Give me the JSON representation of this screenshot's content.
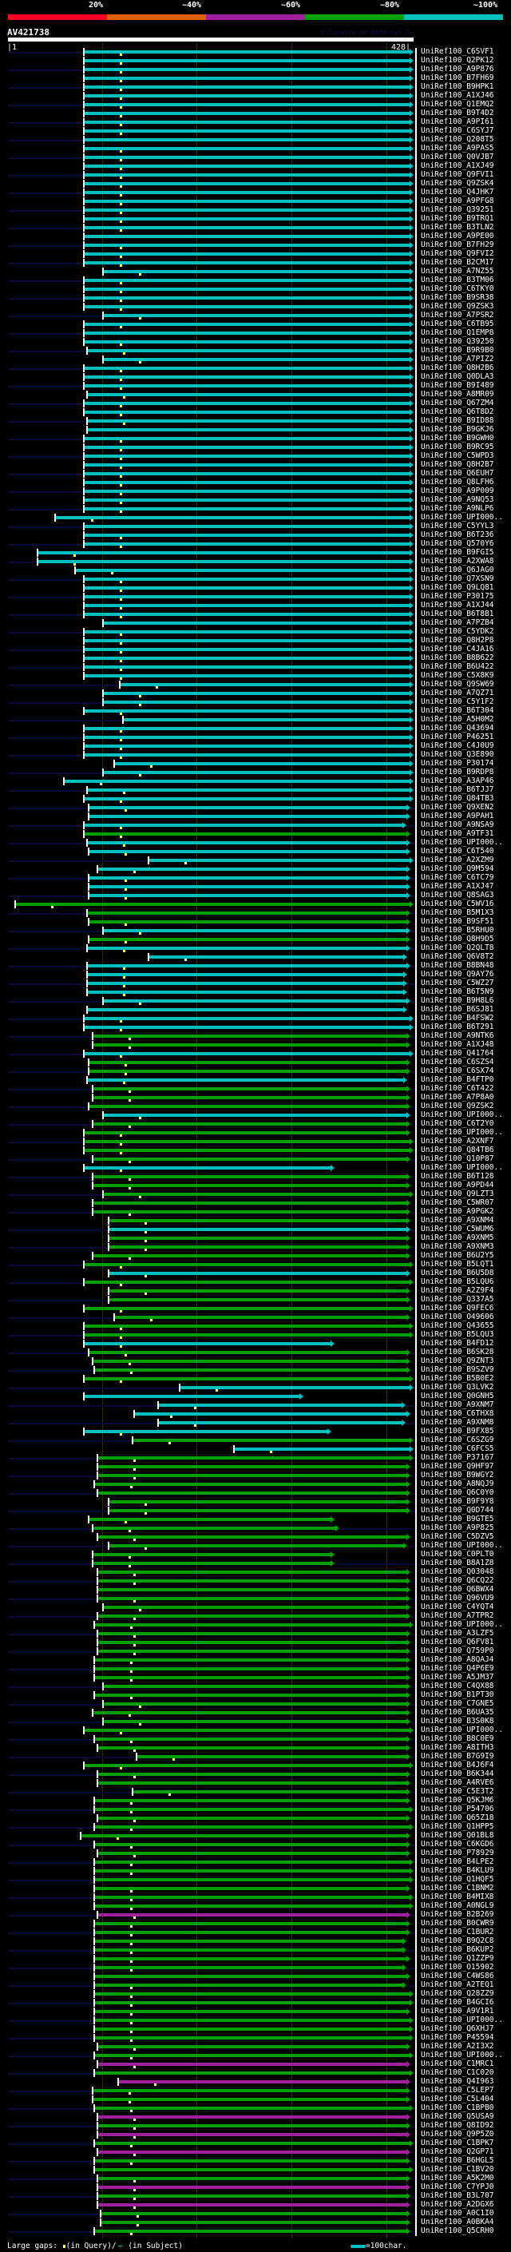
{
  "identity_legend": [
    {
      "label": "20%",
      "color": "#ff0022"
    },
    {
      "label": "~40%",
      "color": "#e06000"
    },
    {
      "label": "~60%",
      "color": "#a020a0"
    },
    {
      "label": "~80%",
      "color": "#00a000"
    },
    {
      "label": "~100%",
      "color": "#00c0c0"
    }
  ],
  "colors": {
    "c": "#00c0c0",
    "g": "#00a000",
    "m": "#a020a0"
  },
  "query": {
    "name": "AV421738",
    "version": "AlignView.pm Beta rel.7",
    "start_label": "|1",
    "end_label": "428|",
    "length": 428
  },
  "footer": {
    "large_gaps": "Large gaps:",
    "in_query": "(in Query)/",
    "in_subject": "(in Subject)",
    "scale": "=100char."
  },
  "rows": [
    [
      "UniRef100_C6SVF1",
      "c",
      81,
      425
    ],
    [
      "UniRef100_Q2PK12",
      "c",
      81,
      425
    ],
    [
      "UniRef100_A9P876",
      "c",
      81,
      425
    ],
    [
      "UniRef100_B7FH69",
      "c",
      81,
      425
    ],
    [
      "UniRef100_B9HPK1",
      "c",
      81,
      425
    ],
    [
      "UniRef100_A1XJ46",
      "c",
      81,
      425
    ],
    [
      "UniRef100_Q1EMQ2",
      "c",
      81,
      425
    ],
    [
      "UniRef100_B9T4D2",
      "c",
      81,
      425
    ],
    [
      "UniRef100_A9PI61",
      "c",
      81,
      425
    ],
    [
      "UniRef100_C6SYJ7",
      "c",
      81,
      425
    ],
    [
      "UniRef100_Q208T5",
      "c",
      81,
      425
    ],
    [
      "UniRef100_A9PAS5",
      "c",
      81,
      425
    ],
    [
      "UniRef100_Q0VJB7",
      "c",
      81,
      425
    ],
    [
      "UniRef100_A1XJ49",
      "c",
      81,
      425
    ],
    [
      "UniRef100_Q9FVI1",
      "c",
      81,
      425
    ],
    [
      "UniRef100_Q9ZSK4",
      "c",
      81,
      425
    ],
    [
      "UniRef100_Q4JHK7",
      "c",
      81,
      425
    ],
    [
      "UniRef100_A9PFG8",
      "c",
      81,
      425
    ],
    [
      "UniRef100_Q39251",
      "c",
      81,
      425
    ],
    [
      "UniRef100_B9TRQ1",
      "c",
      81,
      425
    ],
    [
      "UniRef100_B3TLN2",
      "c",
      81,
      425
    ],
    [
      "UniRef100_A9PE00",
      "c",
      81,
      425
    ],
    [
      "UniRef100_B7FH29",
      "c",
      81,
      425
    ],
    [
      "UniRef100_Q9FVI2",
      "c",
      81,
      425
    ],
    [
      "UniRef100_B2CM17",
      "c",
      81,
      425
    ],
    [
      "UniRef100_A7NZ55",
      "c",
      101,
      425
    ],
    [
      "UniRef100_B3TM06",
      "c",
      81,
      425
    ],
    [
      "UniRef100_C6TKY0",
      "c",
      81,
      425
    ],
    [
      "UniRef100_B9SR38",
      "c",
      81,
      425
    ],
    [
      "UniRef100_Q9ZSK3",
      "c",
      81,
      425
    ],
    [
      "UniRef100_A7PSR2",
      "c",
      101,
      425
    ],
    [
      "UniRef100_C6TB95",
      "c",
      81,
      425
    ],
    [
      "UniRef100_Q1EMP8",
      "c",
      81,
      425
    ],
    [
      "UniRef100_Q39250",
      "c",
      81,
      425
    ],
    [
      "UniRef100_B9R9B0",
      "c",
      84,
      425
    ],
    [
      "UniRef100_A7PIZ2",
      "c",
      101,
      425
    ],
    [
      "UniRef100_Q8H2B6",
      "c",
      81,
      425
    ],
    [
      "UniRef100_Q0DLA3",
      "c",
      81,
      425
    ],
    [
      "UniRef100_B9I489",
      "c",
      81,
      425
    ],
    [
      "UniRef100_A8MR09",
      "c",
      84,
      425
    ],
    [
      "UniRef100_Q67ZM4",
      "c",
      81,
      425
    ],
    [
      "UniRef100_Q6T8D2",
      "c",
      81,
      425
    ],
    [
      "UniRef100_B9ID88",
      "c",
      84,
      425
    ],
    [
      "UniRef100_B9GKJ6",
      "c",
      84,
      425
    ],
    [
      "UniRef100_B9GWH0",
      "c",
      81,
      425
    ],
    [
      "UniRef100_B9RC95",
      "c",
      81,
      425
    ],
    [
      "UniRef100_C5WPD3",
      "c",
      81,
      425
    ],
    [
      "UniRef100_Q8H2B7",
      "c",
      81,
      425
    ],
    [
      "UniRef100_Q6EUH7",
      "c",
      81,
      425
    ],
    [
      "UniRef100_Q8LFH6",
      "c",
      81,
      425
    ],
    [
      "UniRef100_A9P009",
      "c",
      81,
      425
    ],
    [
      "UniRef100_A9NQ53",
      "c",
      81,
      425
    ],
    [
      "UniRef100_A9NLP6",
      "c",
      81,
      425
    ],
    [
      "UniRef100_UPI000..",
      "c",
      51,
      425
    ],
    [
      "UniRef100_C5YYL3",
      "c",
      81,
      425
    ],
    [
      "UniRef100_B6T236",
      "c",
      81,
      425
    ],
    [
      "UniRef100_Q570Y6",
      "c",
      81,
      425
    ],
    [
      "UniRef100_B9FGI5",
      "c",
      32,
      425
    ],
    [
      "UniRef100_A2XWA8",
      "c",
      32,
      425
    ],
    [
      "UniRef100_Q6JAG0",
      "c",
      72,
      425
    ],
    [
      "UniRef100_Q7XSN9",
      "c",
      81,
      425
    ],
    [
      "UniRef100_Q9LQ81",
      "c",
      81,
      425
    ],
    [
      "UniRef100_P30175",
      "c",
      81,
      425
    ],
    [
      "UniRef100_A1XJ44",
      "c",
      81,
      425
    ],
    [
      "UniRef100_B6T8B1",
      "c",
      81,
      425
    ],
    [
      "UniRef100_A7PZB4",
      "c",
      101,
      425
    ],
    [
      "UniRef100_C5YDK2",
      "c",
      81,
      425
    ],
    [
      "UniRef100_Q8H2P8",
      "c",
      81,
      425
    ],
    [
      "UniRef100_C4JA16",
      "c",
      81,
      425
    ],
    [
      "UniRef100_B8B622",
      "c",
      81,
      425
    ],
    [
      "UniRef100_B6U422",
      "c",
      81,
      425
    ],
    [
      "UniRef100_C5X8K9",
      "c",
      81,
      425
    ],
    [
      "UniRef100_Q9SW69",
      "c",
      119,
      425
    ],
    [
      "UniRef100_A7QZ71",
      "c",
      101,
      425
    ],
    [
      "UniRef100_C5Y1F2",
      "c",
      101,
      425
    ],
    [
      "UniRef100_B6T304",
      "c",
      81,
      425
    ],
    [
      "UniRef100_A5H0M2",
      "c",
      122,
      425
    ],
    [
      "UniRef100_Q43694",
      "c",
      81,
      425
    ],
    [
      "UniRef100_P46251",
      "c",
      81,
      425
    ],
    [
      "UniRef100_C4J0U9",
      "c",
      81,
      425
    ],
    [
      "UniRef100_Q3E890",
      "c",
      81,
      425
    ],
    [
      "UniRef100_P30174",
      "c",
      113,
      425
    ],
    [
      "UniRef100_B9RDP8",
      "c",
      101,
      425
    ],
    [
      "UniRef100_A3AP46",
      "c",
      60,
      425
    ],
    [
      "UniRef100_B6TJJ7",
      "c",
      84,
      425
    ],
    [
      "UniRef100_Q84TB3",
      "c",
      81,
      425
    ],
    [
      "UniRef100_Q9XEN2",
      "c",
      86,
      421
    ],
    [
      "UniRef100_A9PAH1",
      "c",
      86,
      421
    ],
    [
      "UniRef100_A9NSA9",
      "c",
      81,
      417
    ],
    [
      "UniRef100_A9TF31",
      "g",
      81,
      421
    ],
    [
      "UniRef100_UPI000..",
      "c",
      84,
      421
    ],
    [
      "UniRef100_C6T540",
      "c",
      86,
      421
    ],
    [
      "UniRef100_A2XZM9",
      "c",
      149,
      425
    ],
    [
      "UniRef100_Q9M594",
      "c",
      95,
      421
    ],
    [
      "UniRef100_C6TC79",
      "c",
      86,
      421
    ],
    [
      "UniRef100_A1XJ47",
      "c",
      86,
      421
    ],
    [
      "UniRef100_Q8SAG3",
      "c",
      86,
      421
    ],
    [
      "UniRef100_C5WV16",
      "g",
      9,
      425
    ],
    [
      "UniRef100_B5M1X3",
      "g",
      84,
      421
    ],
    [
      "UniRef100_B9SF51",
      "g",
      86,
      421
    ],
    [
      "UniRef100_B5RHU0",
      "c",
      101,
      421
    ],
    [
      "UniRef100_Q8H9D5",
      "g",
      86,
      421
    ],
    [
      "UniRef100_Q2QLT8",
      "c",
      84,
      421
    ],
    [
      "UniRef100_Q6V8T2",
      "c",
      149,
      418
    ],
    [
      "UniRef100_B8BN48",
      "c",
      84,
      421
    ],
    [
      "UniRef100_Q9AY76",
      "c",
      84,
      418
    ],
    [
      "UniRef100_C5WZ27",
      "c",
      84,
      418
    ],
    [
      "UniRef100_B6T5N9",
      "c",
      84,
      418
    ],
    [
      "UniRef100_B9H8L6",
      "c",
      101,
      421
    ],
    [
      "UniRef100_B6SJ81",
      "c",
      84,
      418
    ],
    [
      "UniRef100_B4FSW2",
      "c",
      81,
      425
    ],
    [
      "UniRef100_B6T291",
      "c",
      81,
      425
    ],
    [
      "UniRef100_A9NTK6",
      "g",
      90,
      421
    ],
    [
      "UniRef100_A1XJ48",
      "g",
      90,
      421
    ],
    [
      "UniRef100_Q41764",
      "c",
      81,
      425
    ],
    [
      "UniRef100_C6SZS4",
      "g",
      86,
      421
    ],
    [
      "UniRef100_C6SX74",
      "g",
      86,
      421
    ],
    [
      "UniRef100_B4FTP0",
      "c",
      84,
      418
    ],
    [
      "UniRef100_C6T422",
      "g",
      90,
      421
    ],
    [
      "UniRef100_A7P8A0",
      "g",
      90,
      421
    ],
    [
      "UniRef100_Q9ZSK2",
      "g",
      86,
      421
    ],
    [
      "UniRef100_UPI000..",
      "c",
      101,
      421
    ],
    [
      "UniRef100_C6T2Y0",
      "g",
      90,
      421
    ],
    [
      "UniRef100_UPI000..",
      "g",
      81,
      421
    ],
    [
      "UniRef100_A2XNF7",
      "g",
      81,
      425
    ],
    [
      "UniRef100_Q84TB6",
      "g",
      81,
      425
    ],
    [
      "UniRef100_Q10P87",
      "g",
      90,
      421
    ],
    [
      "UniRef100_UPI000..",
      "c",
      81,
      341
    ],
    [
      "UniRef100_B6T128",
      "g",
      90,
      421
    ],
    [
      "UniRef100_A9PD44",
      "g",
      90,
      421
    ],
    [
      "UniRef100_Q9LZT3",
      "g",
      101,
      425
    ],
    [
      "UniRef100_C5WR07",
      "g",
      90,
      421
    ],
    [
      "UniRef100_A9PGK2",
      "g",
      90,
      421
    ],
    [
      "UniRef100_A9XNM4",
      "g",
      107,
      421
    ],
    [
      "UniRef100_C5WUM6",
      "c",
      107,
      421
    ],
    [
      "UniRef100_A9XNM5",
      "g",
      107,
      421
    ],
    [
      "UniRef100_A9XNM3",
      "g",
      107,
      421
    ],
    [
      "UniRef100_B6U2Y5",
      "g",
      90,
      421
    ],
    [
      "UniRef100_B5LQT1",
      "g",
      81,
      425
    ],
    [
      "UniRef100_B6U5D8",
      "c",
      107,
      421
    ],
    [
      "UniRef100_B5LQU6",
      "g",
      81,
      425
    ],
    [
      "UniRef100_A2Z9F4",
      "g",
      107,
      421
    ],
    [
      "UniRef100_Q337A5",
      "g",
      107,
      421
    ],
    [
      "UniRef100_Q9FEC6",
      "g",
      81,
      425
    ],
    [
      "UniRef100_O49606",
      "g",
      113,
      421
    ],
    [
      "UniRef100_Q43655",
      "g",
      81,
      425
    ],
    [
      "UniRef100_B5LQU3",
      "g",
      81,
      425
    ],
    [
      "UniRef100_B4FD12",
      "c",
      81,
      341
    ],
    [
      "UniRef100_B6SK28",
      "g",
      86,
      421
    ],
    [
      "UniRef100_Q9ZNT3",
      "g",
      90,
      421
    ],
    [
      "UniRef100_B9SZV9",
      "g",
      92,
      421
    ],
    [
      "UniRef100_B5B0E2",
      "g",
      81,
      425
    ],
    [
      "UniRef100_Q3LVK2",
      "c",
      182,
      425
    ],
    [
      "UniRef100_Q0GNH5",
      "c",
      81,
      308
    ],
    [
      "UniRef100_A9XNM7",
      "c",
      159,
      416
    ],
    [
      "UniRef100_C6THX8",
      "c",
      134,
      421
    ],
    [
      "UniRef100_A9XNM8",
      "c",
      159,
      416
    ],
    [
      "UniRef100_B9FX85",
      "c",
      81,
      338
    ],
    [
      "UniRef100_C6SZG9",
      "g",
      132,
      425
    ],
    [
      "UniRef100_C6FCS5",
      "c",
      239,
      425
    ],
    [
      "UniRef100_P37167",
      "g",
      95,
      425
    ],
    [
      "UniRef100_Q9HF97",
      "g",
      95,
      421
    ],
    [
      "UniRef100_B9WGY2",
      "g",
      95,
      421
    ],
    [
      "UniRef100_A8NQJ9",
      "g",
      92,
      421
    ],
    [
      "UniRef100_Q6C0Y0",
      "g",
      95,
      421
    ],
    [
      "UniRef100_B9F9Y8",
      "g",
      107,
      421
    ],
    [
      "UniRef100_Q0D744",
      "g",
      107,
      421
    ],
    [
      "UniRef100_B9GTE5",
      "g",
      86,
      341
    ],
    [
      "UniRef100_A9P825",
      "g",
      90,
      346
    ],
    [
      "UniRef100_C5DZV5",
      "g",
      95,
      421
    ],
    [
      "UniRef100_UPI000..",
      "g",
      107,
      418
    ],
    [
      "UniRef100_C0PLT0",
      "g",
      90,
      341
    ],
    [
      "UniRef100_B8A1Z8",
      "g",
      90,
      341
    ],
    [
      "UniRef100_Q03048",
      "g",
      95,
      421
    ],
    [
      "UniRef100_Q6CQ22",
      "g",
      95,
      421
    ],
    [
      "UniRef100_Q6BWX4",
      "g",
      95,
      421
    ],
    [
      "UniRef100_Q96VU9",
      "g",
      95,
      421
    ],
    [
      "UniRef100_C4YQT4",
      "g",
      101,
      421
    ],
    [
      "UniRef100_A7TPR2",
      "g",
      95,
      421
    ],
    [
      "UniRef100_UPI000..",
      "g",
      92,
      425
    ],
    [
      "UniRef100_A3LZF5",
      "g",
      95,
      421
    ],
    [
      "UniRef100_Q6FV81",
      "g",
      95,
      421
    ],
    [
      "UniRef100_Q759P0",
      "g",
      95,
      421
    ],
    [
      "UniRef100_A8QAJ4",
      "g",
      92,
      421
    ],
    [
      "UniRef100_Q4P6E9",
      "g",
      92,
      421
    ],
    [
      "UniRef100_A5JM37",
      "g",
      92,
      421
    ],
    [
      "UniRef100_C4QX88",
      "g",
      101,
      421
    ],
    [
      "UniRef100_B1PT30",
      "g",
      92,
      421
    ],
    [
      "UniRef100_C7GNE5",
      "g",
      101,
      421
    ],
    [
      "UniRef100_B6UA35",
      "g",
      90,
      421
    ],
    [
      "UniRef100_B3S0K8",
      "g",
      101,
      421
    ],
    [
      "UniRef100_UPI000..",
      "g",
      81,
      425
    ],
    [
      "UniRef100_B8C0E9",
      "g",
      92,
      421
    ],
    [
      "UniRef100_A8ITH3",
      "g",
      95,
      421
    ],
    [
      "UniRef100_B7G9I9",
      "g",
      137,
      421
    ],
    [
      "UniRef100_B4J6F4",
      "g",
      81,
      425
    ],
    [
      "UniRef100_B6K344",
      "g",
      95,
      421
    ],
    [
      "UniRef100_A4RVE6",
      "g",
      95,
      421
    ],
    [
      "UniRef100_C5E3T2",
      "g",
      132,
      421
    ],
    [
      "UniRef100_Q5KJM6",
      "g",
      92,
      421
    ],
    [
      "UniRef100_P54706",
      "g",
      92,
      425
    ],
    [
      "UniRef100_Q65Z18",
      "g",
      95,
      421
    ],
    [
      "UniRef100_Q1HPP5",
      "g",
      92,
      425
    ],
    [
      "UniRef100_Q01BL8",
      "g",
      78,
      421
    ],
    [
      "UniRef100_C6KGD6",
      "g",
      92,
      421
    ],
    [
      "UniRef100_P78929",
      "g",
      95,
      421
    ],
    [
      "UniRef100_B4LPE2",
      "g",
      92,
      425
    ],
    [
      "UniRef100_B4KLU9",
      "g",
      92,
      425
    ],
    [
      "UniRef100_Q1HQF5",
      "g",
      92,
      425
    ],
    [
      "UniRef100_C1BNM2",
      "g",
      92,
      421
    ],
    [
      "UniRef100_B4MIX8",
      "g",
      92,
      425
    ],
    [
      "UniRef100_A0NGL9",
      "g",
      92,
      425
    ],
    [
      "UniRef100_B2B269",
      "m",
      95,
      421
    ],
    [
      "UniRef100_B0CWR9",
      "g",
      92,
      421
    ],
    [
      "UniRef100_C1BUR2",
      "g",
      92,
      421
    ],
    [
      "UniRef100_B9Q2C8",
      "g",
      92,
      417
    ],
    [
      "UniRef100_B6KUP2",
      "g",
      92,
      417
    ],
    [
      "UniRef100_Q1ZZP9",
      "g",
      92,
      421
    ],
    [
      "UniRef100_O15902",
      "g",
      92,
      417
    ],
    [
      "UniRef100_C4WS86",
      "g",
      92,
      421
    ],
    [
      "UniRef100_A2TEQ1",
      "g",
      92,
      417
    ],
    [
      "UniRef100_Q28ZZ9",
      "g",
      92,
      425
    ],
    [
      "UniRef100_B4GCI6",
      "g",
      92,
      425
    ],
    [
      "UniRef100_A9V1R1",
      "g",
      92,
      421
    ],
    [
      "UniRef100_UPI000..",
      "g",
      92,
      425
    ],
    [
      "UniRef100_Q6XHJ7",
      "g",
      92,
      425
    ],
    [
      "UniRef100_P45594",
      "g",
      92,
      425
    ],
    [
      "UniRef100_A2I3X2",
      "g",
      95,
      421
    ],
    [
      "UniRef100_UPI000..",
      "g",
      92,
      425
    ],
    [
      "UniRef100_C1MRC1",
      "m",
      95,
      421
    ],
    [
      "UniRef100_C1C020",
      "g",
      92,
      425
    ],
    [
      "UniRef100_Q4I963",
      "m",
      117,
      421
    ],
    [
      "UniRef100_C5LEP7",
      "g",
      90,
      421
    ],
    [
      "UniRef100_C5L404",
      "g",
      90,
      421
    ],
    [
      "UniRef100_C1BPB0",
      "g",
      92,
      425
    ],
    [
      "UniRef100_Q5USA9",
      "m",
      95,
      421
    ],
    [
      "UniRef100_Q8ID92",
      "g",
      95,
      421
    ],
    [
      "UniRef100_Q9P5Z0",
      "m",
      95,
      421
    ],
    [
      "UniRef100_C1BPK7",
      "g",
      92,
      425
    ],
    [
      "UniRef100_Q2GP71",
      "m",
      95,
      421
    ],
    [
      "UniRef100_B6HGL5",
      "g",
      92,
      421
    ],
    [
      "UniRef100_C1BV20",
      "g",
      92,
      425
    ],
    [
      "UniRef100_A5K2M0",
      "g",
      95,
      421
    ],
    [
      "UniRef100_C7YPJ0",
      "m",
      95,
      421
    ],
    [
      "UniRef100_B3L707",
      "g",
      95,
      421
    ],
    [
      "UniRef100_A2DGX6",
      "m",
      95,
      421
    ],
    [
      "UniRef100_A0C1I0",
      "g",
      99,
      421
    ],
    [
      "UniRef100_A0BKA4",
      "g",
      99,
      421
    ],
    [
      "UniRef100_Q5CRH0",
      "g",
      92,
      421
    ]
  ]
}
